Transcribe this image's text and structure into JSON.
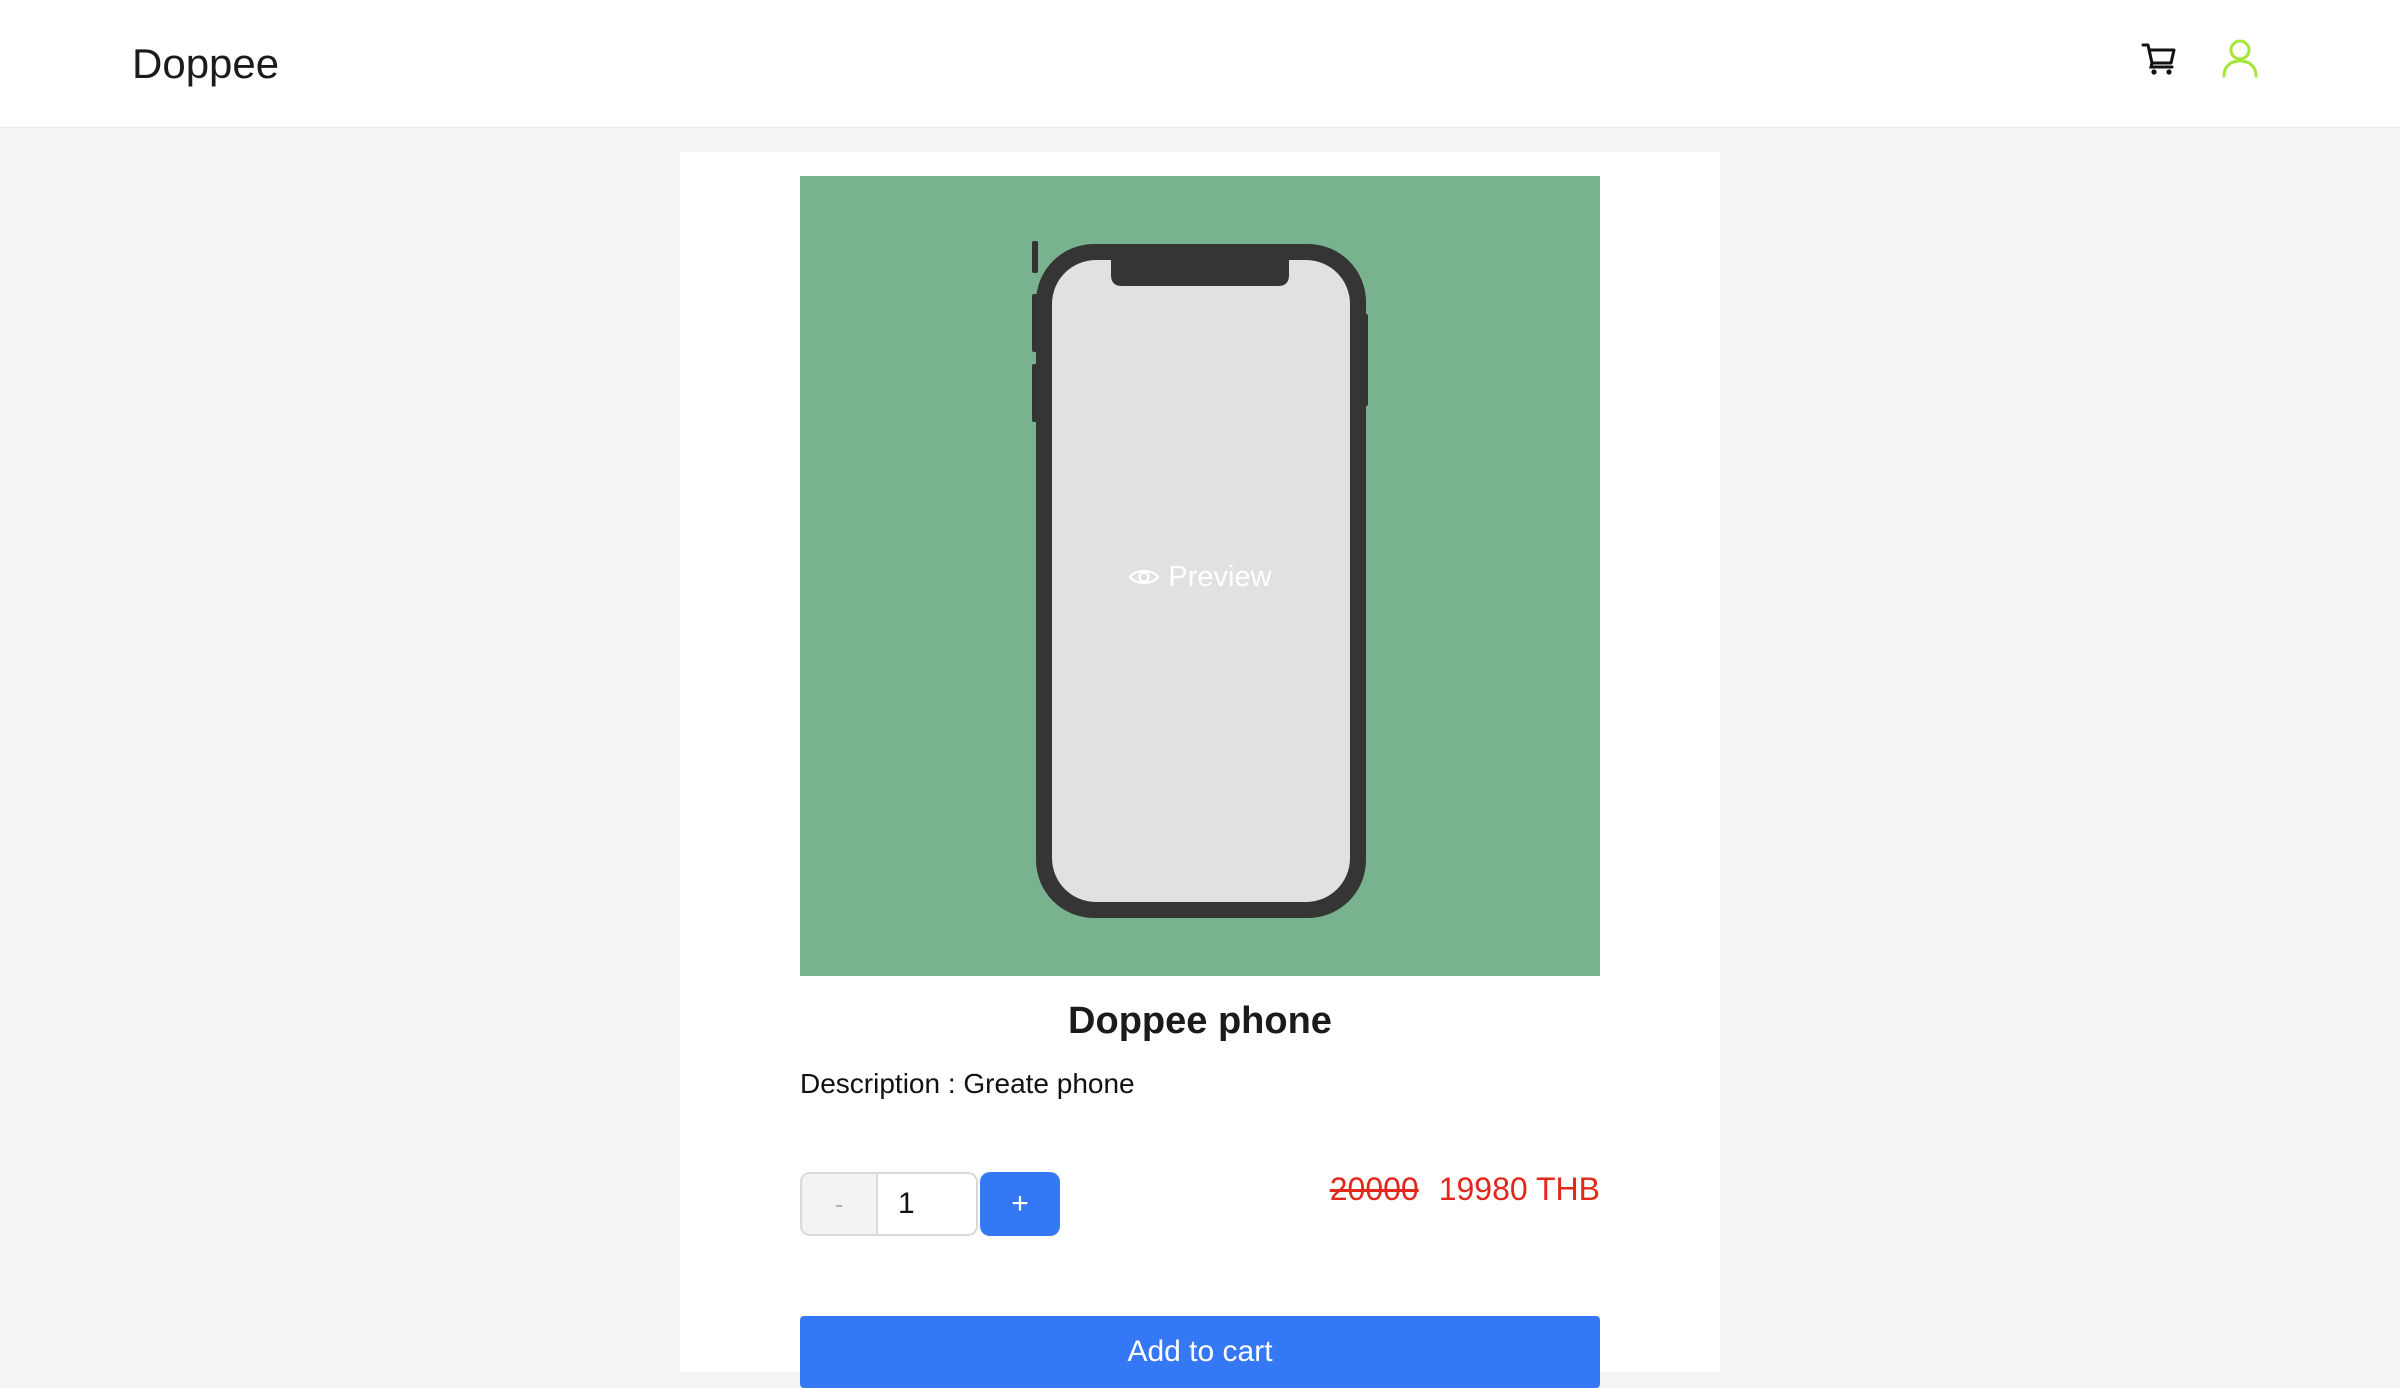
{
  "header": {
    "brand": "Doppee",
    "cart_icon": "cart-icon",
    "user_icon": "user-icon",
    "user_icon_color": "#a3e635"
  },
  "product": {
    "preview_label": "Preview",
    "preview_icon": "eye-icon",
    "image_bg": "#78b28f",
    "name": "Doppee phone",
    "description": "Description : Greate phone",
    "quantity": {
      "minus_label": "-",
      "value": "1",
      "plus_label": "+"
    },
    "price": {
      "original": "20000",
      "current": "19980 THB",
      "color": "#e3271b"
    },
    "add_to_cart_label": "Add to cart",
    "accent": "#3578f6"
  }
}
